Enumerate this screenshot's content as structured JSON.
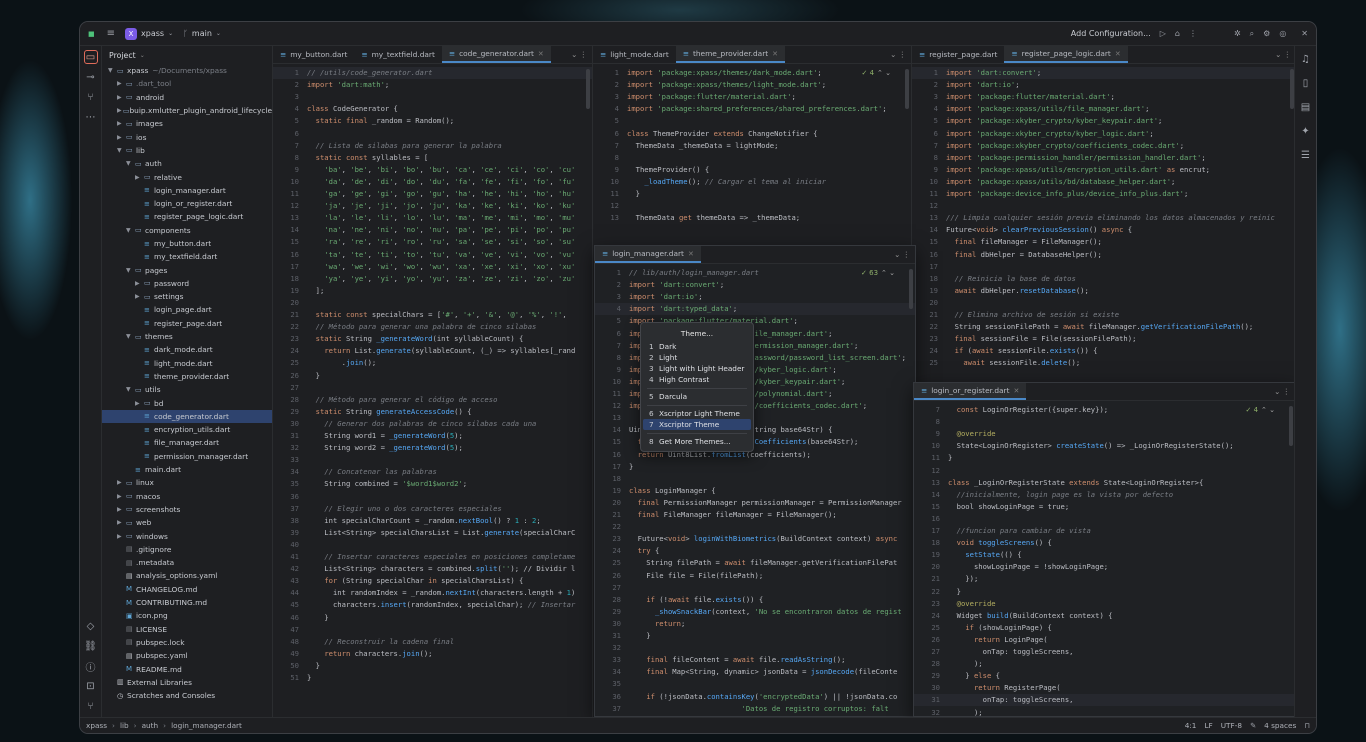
{
  "titlebar": {
    "project": "xpass",
    "project_badge": "X",
    "branch": "main",
    "run_config": "Add Configuration..."
  },
  "project_panel": {
    "title": "Project",
    "items": [
      {
        "label": "xpass",
        "suffix": "~/Documents/xpass",
        "depth": 0,
        "open": true,
        "kind": "folder"
      },
      {
        "label": ".dart_tool",
        "depth": 1,
        "kind": "folder",
        "muted": true
      },
      {
        "label": "android",
        "depth": 1,
        "kind": "folder"
      },
      {
        "label": "buip.xmlutter_plugin_android_lifecycle",
        "depth": 1,
        "kind": "folder"
      },
      {
        "label": "images",
        "depth": 1,
        "kind": "folder"
      },
      {
        "label": "ios",
        "depth": 1,
        "kind": "folder"
      },
      {
        "label": "lib",
        "depth": 1,
        "open": true,
        "kind": "folder"
      },
      {
        "label": "auth",
        "depth": 2,
        "open": true,
        "kind": "folder"
      },
      {
        "label": "relative",
        "depth": 3,
        "kind": "folder"
      },
      {
        "label": "login_manager.dart",
        "depth": 3,
        "kind": "dart"
      },
      {
        "label": "login_or_register.dart",
        "depth": 3,
        "kind": "dart"
      },
      {
        "label": "register_page_logic.dart",
        "depth": 3,
        "kind": "dart"
      },
      {
        "label": "components",
        "depth": 2,
        "open": true,
        "kind": "folder"
      },
      {
        "label": "my_button.dart",
        "depth": 3,
        "kind": "dart"
      },
      {
        "label": "my_textfield.dart",
        "depth": 3,
        "kind": "dart"
      },
      {
        "label": "pages",
        "depth": 2,
        "open": true,
        "kind": "folder"
      },
      {
        "label": "password",
        "depth": 3,
        "kind": "folder"
      },
      {
        "label": "settings",
        "depth": 3,
        "kind": "folder"
      },
      {
        "label": "login_page.dart",
        "depth": 3,
        "kind": "dart"
      },
      {
        "label": "register_page.dart",
        "depth": 3,
        "kind": "dart"
      },
      {
        "label": "themes",
        "depth": 2,
        "open": true,
        "kind": "folder"
      },
      {
        "label": "dark_mode.dart",
        "depth": 3,
        "kind": "dart"
      },
      {
        "label": "light_mode.dart",
        "depth": 3,
        "kind": "dart"
      },
      {
        "label": "theme_provider.dart",
        "depth": 3,
        "kind": "dart"
      },
      {
        "label": "utils",
        "depth": 2,
        "open": true,
        "kind": "folder"
      },
      {
        "label": "bd",
        "depth": 3,
        "kind": "folder"
      },
      {
        "label": "code_generator.dart",
        "depth": 3,
        "kind": "dart",
        "selected": true
      },
      {
        "label": "encryption_utils.dart",
        "depth": 3,
        "kind": "dart"
      },
      {
        "label": "file_manager.dart",
        "depth": 3,
        "kind": "dart"
      },
      {
        "label": "permission_manager.dart",
        "depth": 3,
        "kind": "dart"
      },
      {
        "label": "main.dart",
        "depth": 2,
        "kind": "dart"
      },
      {
        "label": "linux",
        "depth": 1,
        "kind": "folder"
      },
      {
        "label": "macos",
        "depth": 1,
        "kind": "folder"
      },
      {
        "label": "screenshots",
        "depth": 1,
        "kind": "folder"
      },
      {
        "label": "web",
        "depth": 1,
        "kind": "folder"
      },
      {
        "label": "windows",
        "depth": 1,
        "kind": "folder"
      },
      {
        "label": ".gitignore",
        "depth": 1,
        "kind": "file"
      },
      {
        "label": ".metadata",
        "depth": 1,
        "kind": "file"
      },
      {
        "label": "analysis_options.yaml",
        "depth": 1,
        "kind": "yaml"
      },
      {
        "label": "CHANGELOG.md",
        "depth": 1,
        "kind": "md"
      },
      {
        "label": "CONTRIBUTING.md",
        "depth": 1,
        "kind": "md"
      },
      {
        "label": "icon.png",
        "depth": 1,
        "kind": "img"
      },
      {
        "label": "LICENSE",
        "depth": 1,
        "kind": "file"
      },
      {
        "label": "pubspec.lock",
        "depth": 1,
        "kind": "file"
      },
      {
        "label": "pubspec.yaml",
        "depth": 1,
        "kind": "yaml"
      },
      {
        "label": "README.md",
        "depth": 1,
        "kind": "md"
      },
      {
        "label": "External Libraries",
        "depth": 0,
        "kind": "lib"
      },
      {
        "label": "Scratches and Consoles",
        "depth": 0,
        "kind": "scratch"
      }
    ]
  },
  "editors": [
    {
      "tabs": [
        "my_button.dart",
        "my_textfield.dart",
        "code_generator.dart"
      ],
      "active": 2,
      "badge": "34",
      "lines": [
        "// /utils/code_generator.dart",
        "import 'dart:math';",
        "",
        "class CodeGenerator {",
        "  static final _random = Random();",
        "",
        "  // Lista de silabas para generar la palabra",
        "  static const syllables = [",
        "    'ba', 'be', 'bi', 'bo', 'bu', 'ca', 'ce', 'ci', 'co', 'cu'",
        "    'da', 'de', 'di', 'do', 'du', 'fa', 'fe', 'fi', 'fo', 'fu'",
        "    'ga', 'ge', 'gi', 'go', 'gu', 'ha', 'he', 'hi', 'ho', 'hu'",
        "    'ja', 'je', 'ji', 'jo', 'ju', 'ka', 'ke', 'ki', 'ko', 'ku'",
        "    'la', 'le', 'li', 'lo', 'lu', 'ma', 'me', 'mi', 'mo', 'mu'",
        "    'na', 'ne', 'ni', 'no', 'nu', 'pa', 'pe', 'pi', 'po', 'pu'",
        "    'ra', 're', 'ri', 'ro', 'ru', 'sa', 'se', 'si', 'so', 'su'",
        "    'ta', 'te', 'ti', 'to', 'tu', 'va', 've', 'vi', 'vo', 'vu'",
        "    'wa', 'we', 'wi', 'wo', 'wu', 'xa', 'xe', 'xi', 'xo', 'xu'",
        "    'ya', 'ye', 'yi', 'yo', 'yu', 'za', 'ze', 'zi', 'zo', 'zu'",
        "  ];",
        "",
        "  static const specialChars = ['#', '+', '&', '@', '%', '!',",
        "  // Método para generar una palabra de cinco silabas",
        "  static String _generateWord(int syllableCount) {",
        "    return List.generate(syllableCount, (_) => syllables[_rand",
        "        .join();",
        "  }",
        "",
        "  // Método para generar el código de acceso",
        "  static String generateAccessCode() {",
        "    // Generar dos palabras de cinco silabas cada una",
        "    String word1 = _generateWord(5);",
        "    String word2 = _generateWord(5);",
        "",
        "    // Concatenar las palabras",
        "    String combined = '$word1$word2';",
        "",
        "    // Elegir uno o dos caracteres especiales",
        "    int specialCharCount = _random.nextBool() ? 1 : 2;",
        "    List<String> specialCharsList = List.generate(specialCharC",
        "",
        "    // Insertar caracteres especiales en posiciones completame",
        "    List<String> characters = combined.split(''); // Dividir l",
        "    for (String specialChar in specialCharsList) {",
        "      int randomIndex = _random.nextInt(characters.length + 1)",
        "      characters.insert(randomIndex, specialChar); // Insertar",
        "    }",
        "",
        "    // Reconstruir la cadena final",
        "    return characters.join();",
        "  }",
        "}"
      ]
    },
    {
      "tabs": [
        "light_mode.dart",
        "theme_provider.dart"
      ],
      "active": 1,
      "badge": "4",
      "lines": [
        "import 'package:xpass/themes/dark_mode.dart';",
        "import 'package:xpass/themes/light_mode.dart';",
        "import 'package:flutter/material.dart';",
        "import 'package:shared_preferences/shared_preferences.dart';",
        "",
        "class ThemeProvider extends ChangeNotifier {",
        "  ThemeData _themeData = lightMode;",
        "",
        "  ThemeProvider() {",
        "    _loadTheme(); // Cargar el tema al iniciar",
        "  }",
        "",
        "  ThemeData get themeData => _themeData;"
      ]
    },
    {
      "tabs": [
        "register_page.dart",
        "register_page_logic.dart"
      ],
      "active": 1,
      "badge": "58",
      "lines": [
        "import 'dart:convert';",
        "import 'dart:io';",
        "import 'package:flutter/material.dart';",
        "import 'package:xpass/utils/file_manager.dart';",
        "import 'package:xkyber_crypto/kyber_keypair.dart';",
        "import 'package:xkyber_crypto/kyber_logic.dart';",
        "import 'package:xkyber_crypto/coefficients_codec.dart';",
        "import 'package:permission_handler/permission_handler.dart';",
        "import 'package:xpass/utils/encryption_utils.dart' as encrut;",
        "import 'package:xpass/utils/bd/database_helper.dart';",
        "import 'package:device_info_plus/device_info_plus.dart';",
        "",
        "/// Limpia cualquier sesión previa eliminando los datos almacenados y reinic",
        "Future<void> clearPreviousSession() async {",
        "  final fileManager = FileManager();",
        "  final dbHelper = DatabaseHelper();",
        "",
        "  // Reinicia la base de datos",
        "  await dbHelper.resetDatabase();",
        "",
        "  // Elimina archivo de sesión si existe",
        "  String sessionFilePath = await fileManager.getVerificationFilePath();",
        "  final sessionFile = File(sessionFilePath);",
        "  if (await sessionFile.exists()) {",
        "    await sessionFile.delete();"
      ]
    }
  ],
  "float_login_manager": {
    "tab": "login_manager.dart",
    "badge": "63",
    "lines": [
      "// lib/auth/login_manager.dart",
      "import 'dart:convert';",
      "import 'dart:io';",
      "import 'dart:typed_data';",
      "import 'package:flutter/material.dart';",
      "import 'package:xpass/utils/file_manager.dart';",
      "import 'package:xpass/utils/permission_manager.dart';",
      "import 'package:xpass/pages/password/password_list_screen.dart';",
      "import 'package:xkyber_crypto/kyber_logic.dart';",
      "import 'package:xkyber_crypto/kyber_keypair.dart';",
      "import 'package:xkyber_crypto/polynomial.dart';",
      "import 'package:xkyber_crypto/coefficients_codec.dart';",
      "",
      "Uint8List _decodeFromString(String base64Str) {",
      "  final coefficients = decodeCoefficients(base64Str);",
      "  return Uint8List.fromList(coefficients);",
      "}",
      "",
      "class LoginManager {",
      "  final PermissionManager permissionManager = PermissionManager",
      "  final FileManager fileManager = FileManager();",
      "",
      "  Future<void> loginWithBiometrics(BuildContext context) async",
      "  try {",
      "    String filePath = await fileManager.getVerificationFilePat",
      "    File file = File(filePath);",
      "",
      "    if (!await file.exists()) {",
      "      _showSnackBar(context, 'No se encontraron datos de regist",
      "      return;",
      "    }",
      "",
      "    final fileContent = await file.readAsString();",
      "    final Map<String, dynamic> jsonData = jsonDecode(fileConte",
      "",
      "    if (!jsonData.containsKey('encryptedData') || !jsonData.co",
      "                          'Datos de registro corruptos: falt"
    ]
  },
  "float_login_or_register": {
    "tab": "login_or_register.dart",
    "badge": "4",
    "lines": [
      "  const LoginOrRegister({super.key});",
      "",
      "  @override",
      "  State<LoginOrRegister> createState() => _LoginOrRegisterState();",
      "}",
      "",
      "class _LoginOrRegisterState extends State<LoginOrRegister>{",
      "  //inicialmente, login page es la vista por defecto",
      "  bool showLoginPage = true;",
      "",
      "  //funcion para cambiar de vista",
      "  void toggleScreens() {",
      "    setState(() {",
      "      showLoginPage = !showLoginPage;",
      "    });",
      "  }",
      "  @override",
      "  Widget build(BuildContext context) {",
      "    if (showLoginPage) {",
      "      return LoginPage(",
      "        onTap: toggleScreens,",
      "      );",
      "    } else {",
      "      return RegisterPage(",
      "        onTap: toggleScreens,",
      "      );"
    ]
  },
  "theme_popup": {
    "title": "Theme...",
    "groups": [
      [
        {
          "n": "1",
          "label": "Dark"
        },
        {
          "n": "2",
          "label": "Light"
        },
        {
          "n": "3",
          "label": "Light with Light Header"
        },
        {
          "n": "4",
          "label": "High Contrast"
        }
      ],
      [
        {
          "n": "5",
          "label": "Darcula"
        }
      ],
      [
        {
          "n": "6",
          "label": "Xscriptor Light Theme"
        },
        {
          "n": "7",
          "label": "Xscriptor Theme",
          "selected": true
        }
      ],
      [
        {
          "n": "8",
          "label": "Get More Themes..."
        }
      ]
    ]
  },
  "statusbar": {
    "crumbs": [
      "xpass",
      "lib",
      "auth",
      "login_manager.dart"
    ],
    "position": "4:1",
    "line_sep": "LF",
    "encoding": "UTF-8",
    "indent": "4 spaces"
  }
}
